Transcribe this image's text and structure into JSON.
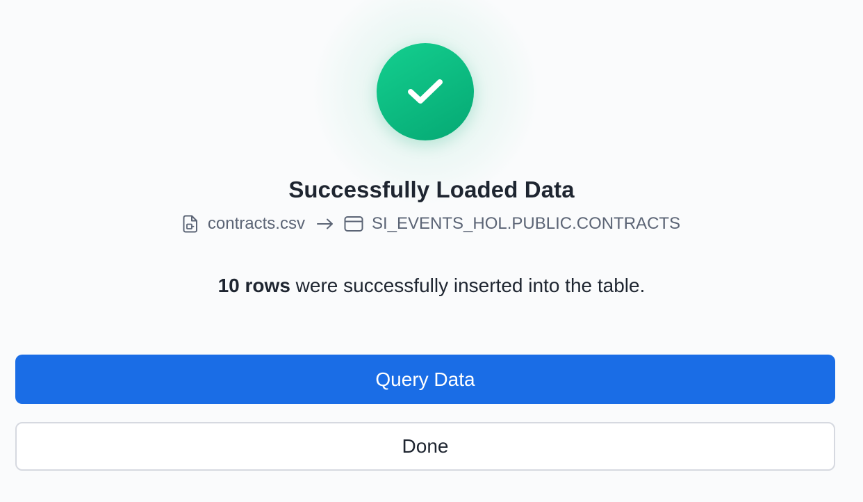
{
  "dialog": {
    "title": "Successfully Loaded Data",
    "source_file": "contracts.csv",
    "target_table": "SI_EVENTS_HOL.PUBLIC.CONTRACTS",
    "message": {
      "count": "10 rows",
      "text": " were successfully inserted into the table."
    },
    "icons": {
      "status": "check-icon",
      "file": "file-icon",
      "arrow": "arrow-right-icon",
      "table": "table-icon"
    }
  },
  "actions": {
    "primary_label": "Query Data",
    "secondary_label": "Done"
  },
  "colors": {
    "success": "#10b981",
    "primary": "#1a6de6",
    "text": "#1e2530",
    "muted": "#5b6475"
  }
}
